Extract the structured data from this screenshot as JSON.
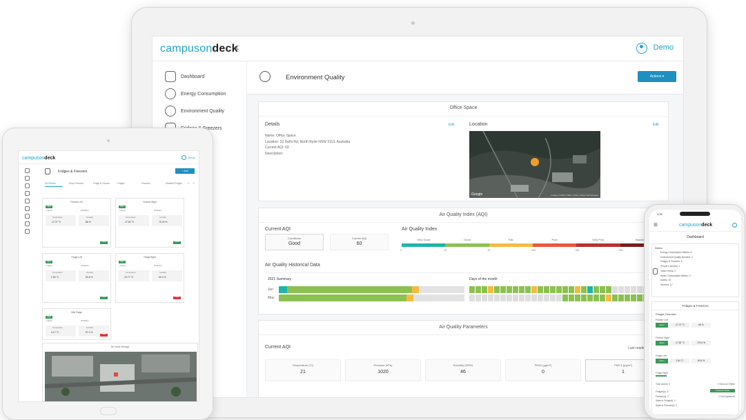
{
  "brand": {
    "prefix": "campuson",
    "suffix": "deck"
  },
  "user": {
    "name": "Demo"
  },
  "sidebar": {
    "items": [
      {
        "label": "Dashboard"
      },
      {
        "label": "Energy Consumption"
      },
      {
        "label": "Environment Quality"
      },
      {
        "label": "Fridges & Freezers"
      },
      {
        "label": "ring"
      },
      {
        "label": "ance"
      },
      {
        "label": "ption"
      }
    ]
  },
  "page": {
    "title": "Environment Quality",
    "actions_label": "Actions"
  },
  "office": {
    "card_title": "Office Space",
    "details_title": "Details",
    "edit": "Edit",
    "name": "Name: Office Space",
    "location": "Location: 32 Delhi Rd, North Ryde NSW 2113, Australia",
    "current_aqi": "Current AQI: 60",
    "description": "Description:",
    "location_title": "Location",
    "map_google": "Google",
    "map_credit": "Imagery ©2022 CNES / Airbus, Maxar Technologies"
  },
  "aqi": {
    "card_title": "Air Quality Index (AQI)",
    "current_title": "Current AQI",
    "conditions_label": "Conditions",
    "conditions_value": "Good",
    "current_label": "Current AQI",
    "current_value": "60",
    "index_title": "Air Quality Index",
    "index_labels": [
      "Very Good",
      "Good",
      "Fair",
      "Poor",
      "Very Poor",
      "Hazardous"
    ],
    "index_ticks": [
      "0",
      "33",
      "67",
      "100",
      "150",
      "200",
      "300"
    ],
    "index_colors": [
      "#1fb5a8",
      "#8cc152",
      "#f6bb42",
      "#e9573f",
      "#b8312f",
      "#7a1e1e"
    ]
  },
  "history": {
    "title": "Air Quality Historical Data",
    "summary_title": "2021 Summary",
    "days_title": "Days of the month",
    "rows": [
      {
        "month": "Jun",
        "teal": "1",
        "green": "28",
        "yellow": "1"
      },
      {
        "month": "May",
        "teal": "",
        "green": "30",
        "yellow": "1"
      }
    ]
  },
  "params": {
    "card_title": "Air Quality Parameters",
    "current_title": "Current AQI",
    "last_reading": "Last reading: 12:12pm",
    "items": [
      {
        "label": "Temperature (°C)",
        "value": "21"
      },
      {
        "label": "Pressure (hPa)",
        "value": "1020"
      },
      {
        "label": "Humidity (%RH)",
        "value": "46"
      },
      {
        "label": "PM10 (μg/m³)",
        "value": "0"
      },
      {
        "label": "PM2.5 (μg/m³)",
        "value": "1"
      }
    ]
  },
  "tablet": {
    "title": "Fridges & Freezers",
    "add_button": "+ Add",
    "tabs": [
      "All Devices",
      "Deep Freezers",
      "Fridge & Freezer",
      "Fridges",
      "Freezers",
      "Disabled Fridges"
    ],
    "cards": [
      {
        "title": "Freezer Left",
        "badge": "Open",
        "info1": "+ Signal",
        "info2": "90 Battery",
        "label1": "Temperature",
        "label2": "Humidity",
        "value1": "-17.37 °C",
        "value2": "86 %",
        "status": "Online"
      },
      {
        "title": "Freezer Right",
        "badge": "Open",
        "info1": "+ Signal",
        "info2": "90 Battery",
        "label1": "Temperature",
        "label2": "Humidity",
        "value1": "-17.82 °C",
        "value2": "76.24 %",
        "status": "Online"
      },
      {
        "title": "Fridge Left",
        "badge": "Open",
        "info1": "+ Signal",
        "info2": "90 Battery",
        "label1": "Temperature",
        "label2": "Humidity",
        "value1": "2.84 °C",
        "value2": "60.5 %",
        "status": "Online"
      },
      {
        "title": "Fridge Right",
        "badge": "Open",
        "info1": "+ Signal",
        "info2": "90 Battery",
        "label1": "Temperature",
        "label2": "Humidity",
        "value1": "20.77 °C",
        "value2": "50.4 %",
        "status": "Offline"
      },
      {
        "title": "Milk Fridge",
        "badge": "Open",
        "info1": "+ Signal",
        "info2": "90 Battery",
        "label1": "Temperature",
        "label2": "Humidity",
        "value1": "4.17 °C",
        "value2": "57.2 %",
        "status": "Offline"
      }
    ],
    "map_title": "Air Cond Storage"
  },
  "phone": {
    "time": "4:30",
    "title": "Dashboard",
    "demo_title": "Demo",
    "demo_items": [
      "Energy Consumption Meters: 8",
      "Environment Quality Monitors: 2",
      "Fridges & Freezers: 5",
      "People Counters: 1",
      "Video Feeds: 2",
      "Water Consumption Meters: 0",
      "Assets: 15",
      "Sensors: 17"
    ],
    "ff_title": "Fridges & Freezers",
    "overview_title": "Fridges Overview",
    "overview": [
      {
        "name": "Freezer Left",
        "badge": "Open",
        "temp": "-17.37 °C",
        "hum": "86 %"
      },
      {
        "name": "Freezer Right",
        "badge": "Open",
        "temp": "-17.82 °C",
        "hum": "76.24 %"
      },
      {
        "name": "Fridge Left",
        "badge": "Open",
        "temp": "2.84 °C",
        "hum": "60.5 %"
      }
    ],
    "fridge_right": "Fridge Right",
    "total_assets": "Total assets: 5",
    "sensors_offline": "0 Sensors Offline",
    "stats": [
      "Fridges(s): 3",
      "Freezer(s): 2",
      "State in Fridge(s): 0",
      "State in Freezer(s): 0"
    ],
    "sensors_online": "5 Sensors Online",
    "not_registered": "0 Not registered"
  }
}
